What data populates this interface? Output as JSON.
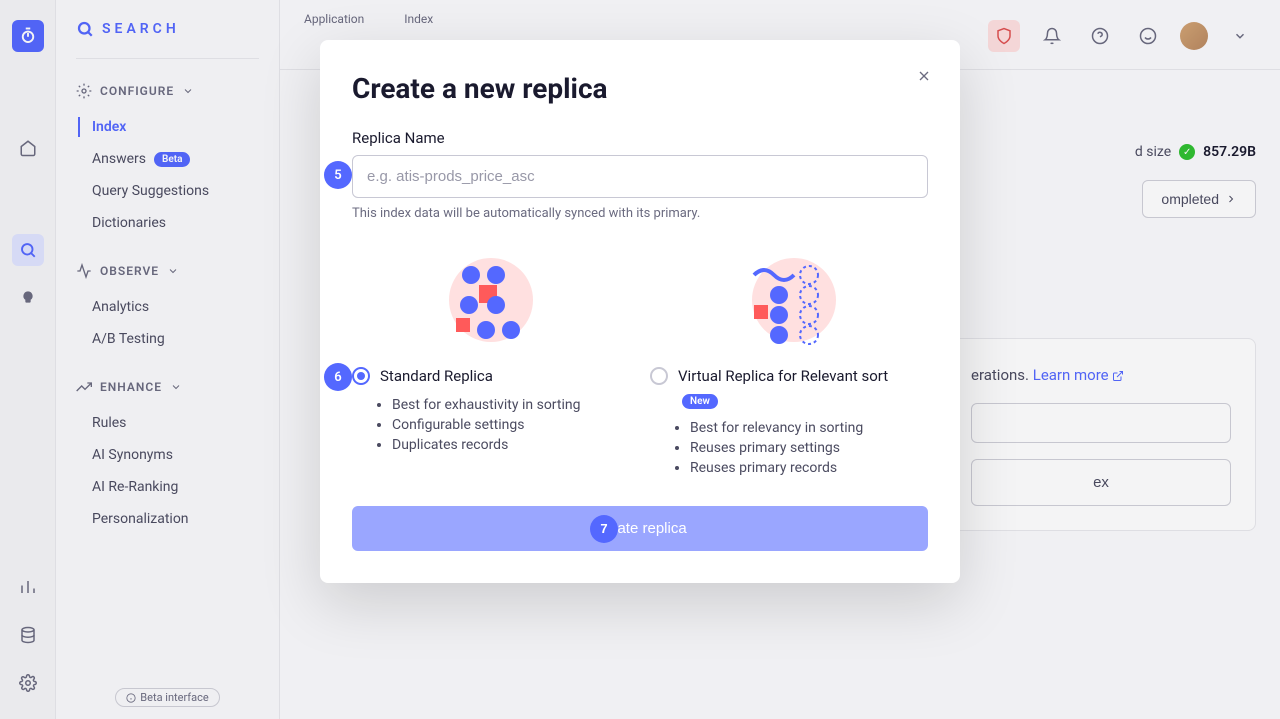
{
  "brand": {
    "title": "SEARCH"
  },
  "sidebar": {
    "sections": [
      {
        "label": "CONFIGURE",
        "items": [
          {
            "label": "Index",
            "active": true
          },
          {
            "label": "Answers",
            "badge": "Beta"
          },
          {
            "label": "Query Suggestions"
          },
          {
            "label": "Dictionaries"
          }
        ]
      },
      {
        "label": "OBSERVE",
        "items": [
          {
            "label": "Analytics"
          },
          {
            "label": "A/B Testing"
          }
        ]
      },
      {
        "label": "ENHANCE",
        "items": [
          {
            "label": "Rules"
          },
          {
            "label": "AI Synonyms"
          },
          {
            "label": "AI Re-Ranking"
          },
          {
            "label": "Personalization"
          }
        ]
      }
    ],
    "footer_badge": "Beta interface"
  },
  "topbar": {
    "crumbs": [
      {
        "label": "Application"
      },
      {
        "label": "Index"
      }
    ]
  },
  "page": {
    "size_label": "d size",
    "size_value": "857.29B",
    "action_completed": "ompleted",
    "info_text": "erations.",
    "learn_more": "Learn more",
    "card_button": "ex"
  },
  "modal": {
    "title": "Create a new replica",
    "field_label": "Replica Name",
    "placeholder": "e.g. atis-prods_price_asc",
    "helper": "This index data will be automatically synced with its primary.",
    "step5": "5",
    "step6": "6",
    "step7": "7",
    "options": [
      {
        "title": "Standard Replica",
        "checked": true,
        "bullets": [
          "Best for exhaustivity in sorting",
          "Configurable settings",
          "Duplicates records"
        ]
      },
      {
        "title": "Virtual Replica for Relevant sort",
        "checked": false,
        "new_badge": "New",
        "bullets": [
          "Best for relevancy in sorting",
          "Reuses primary settings",
          "Reuses primary records"
        ]
      }
    ],
    "create_label": "Create replica"
  }
}
